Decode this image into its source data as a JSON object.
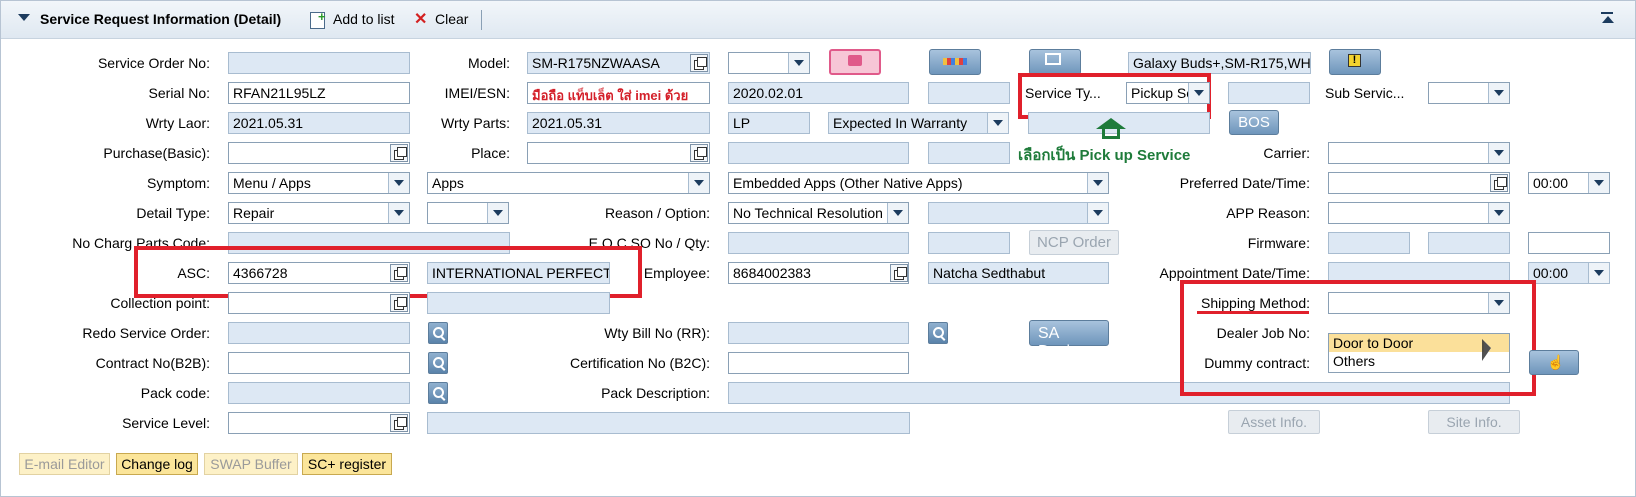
{
  "header": {
    "title": "Service Request Information (Detail)",
    "add_to_list": "Add to list",
    "clear": "Clear",
    "collapse_icon": "collapse-icon"
  },
  "labels": {
    "service_order_no": "Service Order No:",
    "model": "Model:",
    "serial_no": "Serial No:",
    "imei_esn": "IMEI/ESN:",
    "service_type": "Service Ty...",
    "sub_service": "Sub Servic...",
    "wrty_labor": "Wrty Laor:",
    "wrty_parts": "Wrty Parts:",
    "purchase_basic": "Purchase(Basic):",
    "place": "Place:",
    "carrier": "Carrier:",
    "symptom": "Symptom:",
    "preferred_datetime": "Preferred Date/Time:",
    "detail_type": "Detail Type:",
    "reason_option": "Reason / Option:",
    "app_reason": "APP Reason:",
    "no_charg_parts_code": "No Charg Parts Code:",
    "eoc_so_no_qty": "E.O.C SO No / Qty:",
    "firmware": "Firmware:",
    "asc": "ASC:",
    "employee": "Employee:",
    "appointment_datetime": "Appointment Date/Time:",
    "collection_point": "Collection point:",
    "shipping_method": "Shipping Method:",
    "redo_service_order": "Redo Service Order:",
    "wty_bill_no": "Wty Bill No (RR):",
    "dealer_job_no": "Dealer Job No:",
    "contract_no_b2b": "Contract No(B2B):",
    "certification_no_b2c": "Certification No (B2C):",
    "dummy_contract": "Dummy contract:",
    "pack_code": "Pack code:",
    "pack_description": "Pack Description:",
    "service_level": "Service Level:"
  },
  "values": {
    "model": "SM-R175NZWAASA",
    "product_desc": "Galaxy Buds+,SM-R175,WH",
    "serial_no": "RFAN21L95LZ",
    "imei_note": "มือถือ แท็บเล็ต ใส่ imei ด้วย",
    "purchase_date": "2020.02.01",
    "service_type": "Pickup Se",
    "wrty_labor": "2021.05.31",
    "wrty_parts": "2021.05.31",
    "wrty_code": "LP",
    "warranty_status": "Expected In Warranty",
    "symptom_1": "Menu / Apps",
    "symptom_2": "Apps",
    "symptom_3": "Embedded Apps (Other Native Apps)",
    "preferred_time": "00:00",
    "detail_type": "Repair",
    "reason_option": "No Technical Resolution",
    "asc_code": "4366728",
    "asc_name": "INTERNATIONAL PERFECT",
    "employee_id": "8684002383",
    "employee_name": "Natcha Sedthabut",
    "appointment_time": "00:00"
  },
  "buttons": {
    "bos": "BOS",
    "ncp_order": "NCP Order",
    "sa_device": "SA Device",
    "asset_info": "Asset Info.",
    "site_info": "Site Info.",
    "email_editor": "E-mail Editor",
    "change_log": "Change log",
    "swap_buffer": "SWAP Buffer",
    "sc_register": "SC+ register"
  },
  "annotation": {
    "pickup_note": "เลือกเป็น Pick up Service"
  },
  "shipping_dropdown": {
    "options": [
      "Door to Door",
      "Others"
    ],
    "highlighted": "Door to Door"
  },
  "colors": {
    "annotation_red": "#e0202b",
    "annotation_green": "#1e7b3a",
    "readonly_fill": "#dde8f4",
    "highlight_yellow": "#fbe09a"
  }
}
